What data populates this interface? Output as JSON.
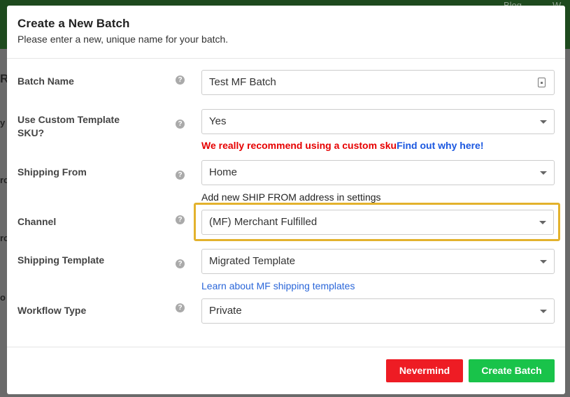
{
  "background": {
    "nav_items": [
      "Blog",
      "W"
    ],
    "side_letters": [
      "R",
      "y",
      "ro",
      "ro",
      "o"
    ]
  },
  "modal": {
    "title": "Create a New Batch",
    "subtitle": "Please enter a new, unique name for your batch."
  },
  "help_glyph": "?",
  "fields": {
    "batch_name": {
      "label": "Batch Name",
      "value": "Test MF Batch"
    },
    "custom_sku": {
      "label": "Use Custom Template SKU?",
      "value": "Yes",
      "warning_text": "We really recommend using a custom sku",
      "warning_link": "Find out why here!"
    },
    "shipping_from": {
      "label": "Shipping From",
      "value": "Home",
      "hint": "Add new SHIP FROM address in settings"
    },
    "channel": {
      "label": "Channel",
      "value": "(MF) Merchant Fulfilled"
    },
    "shipping_template": {
      "label": "Shipping Template",
      "value": "Migrated Template",
      "link": "Learn about MF shipping templates"
    },
    "workflow_type": {
      "label": "Workflow Type",
      "value": "Private"
    }
  },
  "footer": {
    "nevermind_label": "Nevermind",
    "create_label": "Create Batch"
  },
  "colors": {
    "highlight": "#e3b22d",
    "danger": "#ee1c24",
    "success": "#19c34a",
    "link": "#1a57e0"
  }
}
